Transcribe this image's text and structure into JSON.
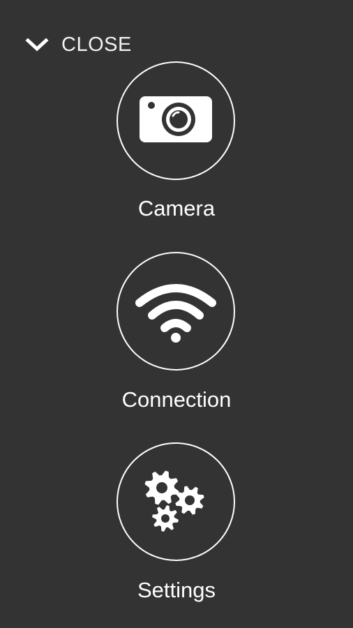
{
  "header": {
    "close_label": "CLOSE",
    "close_icon": "chevron-down-icon"
  },
  "menu": {
    "items": [
      {
        "label": "Camera",
        "icon": "camera-icon"
      },
      {
        "label": "Connection",
        "icon": "wifi-icon"
      },
      {
        "label": "Settings",
        "icon": "gears-icon"
      }
    ]
  },
  "colors": {
    "background": "#333333",
    "foreground": "#ffffff"
  }
}
